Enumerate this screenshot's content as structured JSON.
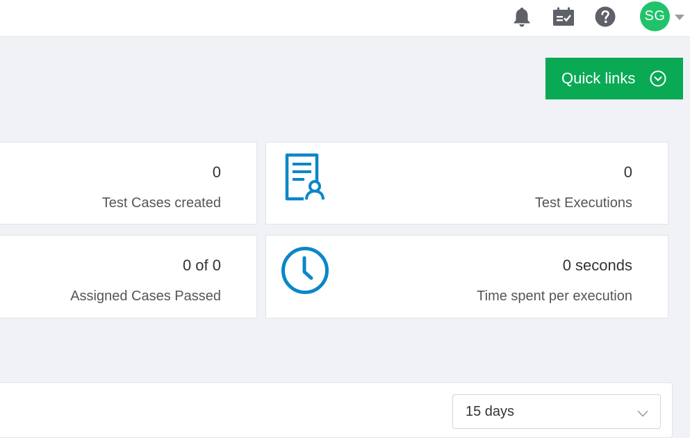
{
  "header": {
    "user_initials": "SG",
    "avatar_color": "#20c36a",
    "icons": [
      "bell-icon",
      "calendar-check-icon",
      "help-icon",
      "chevron-down-icon"
    ]
  },
  "quick_links": {
    "label": "Quick links",
    "color": "#0aaa55"
  },
  "stats": {
    "test_cases": {
      "value": "0",
      "label": "Test Cases created"
    },
    "test_executions": {
      "value": "0",
      "label": "Test Executions",
      "icon": "document-user-icon"
    },
    "assigned_cases": {
      "value": "0 of 0",
      "label": "Assigned Cases Passed"
    },
    "time_spent": {
      "value": "0 seconds",
      "label": "Time spent per execution",
      "icon": "clock-icon"
    },
    "icon_color": "#0a87c7"
  },
  "filter": {
    "range_value": "15 days"
  }
}
